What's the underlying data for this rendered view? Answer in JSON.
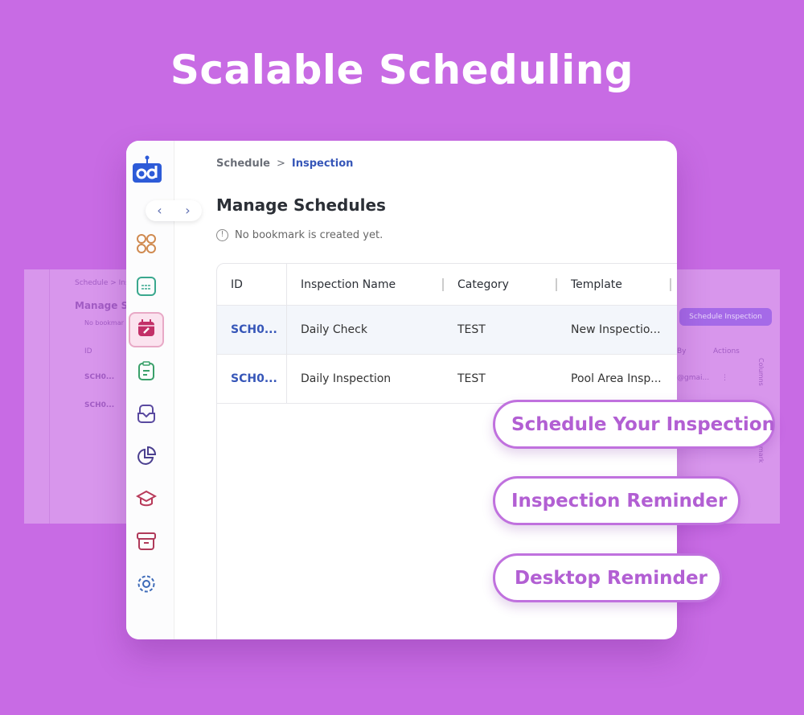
{
  "headline": "Scalable Scheduling",
  "background_app": {
    "breadcrumb": "Schedule  >  Ins",
    "title": "Manage Sc",
    "note": "No bookmar",
    "id_header": "ID",
    "rows": [
      "SCH0...",
      "SCH0..."
    ],
    "schedule_button": "Schedule Inspection",
    "created_by_header": "By",
    "actions_header": "Actions",
    "created_by_cell": "@gmai...",
    "actions_cell": "⋮",
    "columns_label": "Columns",
    "bookmark_label": "Bookmark"
  },
  "app": {
    "breadcrumb": {
      "parent": "Schedule",
      "separator": ">",
      "current": "Inspection"
    },
    "page_title": "Manage Schedules",
    "bookmark_note": "No bookmark is created yet.",
    "nav_back": "‹",
    "nav_forward": "›",
    "sidebar": [
      {
        "icon": "grid-icon",
        "color": "#d08a50"
      },
      {
        "icon": "board-icon",
        "color": "#3aa88e"
      },
      {
        "icon": "calendar-edit-icon",
        "color": "#c23068",
        "active": true
      },
      {
        "icon": "clipboard-icon",
        "color": "#3aa06a"
      },
      {
        "icon": "inbox-icon",
        "color": "#5a4aa0"
      },
      {
        "icon": "pie-chart-icon",
        "color": "#4a3f8f"
      },
      {
        "icon": "graduation-cap-icon",
        "color": "#b83a5a"
      },
      {
        "icon": "archive-icon",
        "color": "#b03a5a"
      },
      {
        "icon": "settings-icon",
        "color": "#3d6ab8"
      }
    ],
    "table": {
      "headers": [
        "ID",
        "Inspection Name",
        "Category",
        "Template"
      ],
      "rows": [
        [
          "SCH0...",
          "Daily Check",
          "TEST",
          "New Inspectio..."
        ],
        [
          "SCH0...",
          "Daily Inspection",
          "TEST",
          "Pool Area Insp..."
        ]
      ]
    }
  },
  "features": [
    "Schedule Your Inspection",
    "Inspection Reminder",
    "Desktop Reminder"
  ],
  "colors": {
    "background": "#c86be4",
    "accent": "#b25fd3",
    "link": "#3656b8"
  }
}
